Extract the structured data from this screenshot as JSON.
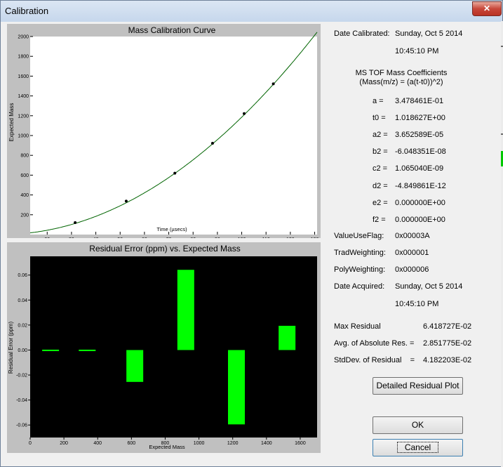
{
  "window": {
    "title": "Calibration",
    "close_glyph": "✕"
  },
  "colors": {
    "bar": "#00ff00",
    "curve": "#006400",
    "residual_bg": "#000000",
    "panel": "#c0c0c0"
  },
  "chart_data": [
    {
      "type": "scatter",
      "title": "Mass Calibration Curve",
      "xlabel": "Time (µsecs)",
      "ylabel": "Expected Mass",
      "xlim": [
        13,
        131
      ],
      "ylim": [
        0,
        2000
      ],
      "x_ticks": [
        20,
        30,
        40,
        50,
        60,
        70,
        80,
        90,
        100,
        110,
        120,
        130
      ],
      "y_ticks": [
        200,
        400,
        600,
        800,
        1000,
        1200,
        1400,
        1600,
        1800,
        2000
      ],
      "points": [
        {
          "x": 31.5,
          "y": 121
        },
        {
          "x": 52.5,
          "y": 338
        },
        {
          "x": 72.5,
          "y": 620
        },
        {
          "x": 88,
          "y": 922
        },
        {
          "x": 101,
          "y": 1222
        },
        {
          "x": 113,
          "y": 1522
        }
      ],
      "fit_curve": "Mass = (a(t-t0))^2"
    },
    {
      "type": "bar",
      "title": "Residual Error (ppm) vs. Expected Mass",
      "xlabel": "Expected Mass",
      "ylabel": "Residual Error (ppm)",
      "xlim": [
        0,
        1700
      ],
      "ylim": [
        -0.07,
        0.075
      ],
      "x_ticks": [
        0,
        200,
        400,
        600,
        800,
        1000,
        1200,
        1400,
        1600
      ],
      "y_ticks": [
        "0.06",
        "0.04",
        "0.02",
        "0.00",
        "-0.02",
        "-0.04",
        "-0.06"
      ],
      "y_tick_values": [
        0.06,
        0.04,
        0.02,
        0.0,
        -0.02,
        -0.04,
        -0.06
      ],
      "bars": [
        {
          "x": 121,
          "value": 0.0003
        },
        {
          "x": 338,
          "value": 0.0003
        },
        {
          "x": 620,
          "value": -0.0255
        },
        {
          "x": 922,
          "value": 0.0642
        },
        {
          "x": 1222,
          "value": -0.0595
        },
        {
          "x": 1522,
          "value": 0.0194
        }
      ]
    }
  ],
  "info": {
    "date_calibrated_label": "Date Calibrated:",
    "date_calibrated": "Sunday, Oct 5 2014",
    "time_calibrated": "10:45:10 PM",
    "coefficients_title": "MS TOF Mass Coefficients",
    "coefficients_formula": "(Mass(m/z) = (a(t-t0))^2)",
    "coefficients": [
      {
        "label": "a =",
        "value": "3.478461E-01"
      },
      {
        "label": "t0 =",
        "value": "1.018627E+00"
      },
      {
        "label": "a2 =",
        "value": "3.652589E-05"
      },
      {
        "label": "b2 =",
        "value": "-6.048351E-08"
      },
      {
        "label": "c2 =",
        "value": "1.065040E-09"
      },
      {
        "label": "d2 =",
        "value": "-4.849861E-12"
      },
      {
        "label": "e2 =",
        "value": "0.000000E+00"
      },
      {
        "label": "f2 =",
        "value": "0.000000E+00"
      }
    ],
    "flags": [
      {
        "label": "ValueUseFlag:",
        "value": "0x00003A"
      },
      {
        "label": "TradWeighting:",
        "value": "0x000001"
      },
      {
        "label": "PolyWeighting:",
        "value": "0x000006"
      }
    ],
    "date_acquired_label": "Date  Acquired:",
    "date_acquired": "Sunday, Oct 5 2014",
    "time_acquired": "10:45:10 PM",
    "stats": [
      {
        "label": "Max Residual",
        "value": "6.418727E-02"
      },
      {
        "label": "Avg. of Absolute Res. =",
        "value": "2.851775E-02"
      },
      {
        "label": "StdDev. of Residual    =",
        "value": "4.182203E-02"
      }
    ]
  },
  "buttons": {
    "detailed": "Detailed Residual Plot",
    "ok": "OK",
    "cancel": "Cancel"
  }
}
